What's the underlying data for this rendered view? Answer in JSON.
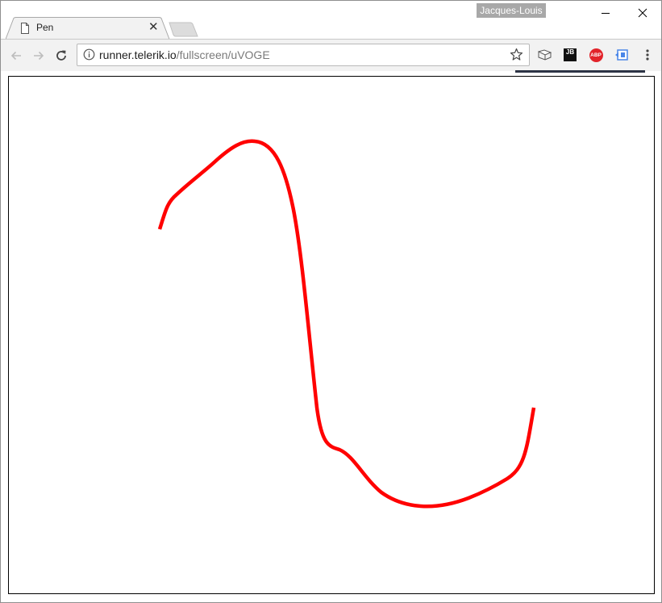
{
  "window": {
    "profile_name": "Jacques-Louis",
    "controls": [
      "minimize-icon",
      "maximize-icon",
      "close-icon"
    ]
  },
  "tabs": [
    {
      "title": "Pen",
      "icon": "page-icon",
      "active": true
    }
  ],
  "toolbar": {
    "url_host": "runner.telerik.io",
    "url_path": "/fullscreen/uVOGE",
    "extensions": [
      "book-icon",
      "jetbrains-icon",
      "adblock-plus-icon",
      "extension-icon"
    ],
    "jb_label": "JB",
    "abp_label": "ABP"
  },
  "canvas": {
    "stroke_color": "#ff0000",
    "border_color": "#000000"
  }
}
